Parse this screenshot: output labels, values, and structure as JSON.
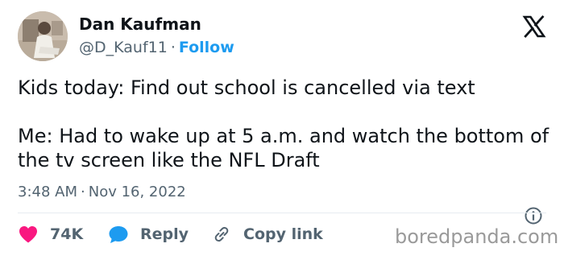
{
  "user": {
    "name": "Dan Kaufman",
    "handle": "@D_Kauf11",
    "separator": "·",
    "follow_label": "Follow"
  },
  "brand_icon": "x-logo-icon",
  "tweet": {
    "paragraphs": [
      "Kids today: Find out school is cancelled via text",
      "Me: Had to wake up at 5 a.m. and watch the bottom of the tv screen like the NFL Draft"
    ],
    "time": "3:48 AM",
    "separator": "·",
    "date": "Nov 16, 2022"
  },
  "actions": {
    "like_count": "74K",
    "reply_label": "Reply",
    "copy_link_label": "Copy link"
  },
  "watermark": "boredpanda.com",
  "colors": {
    "like": "#f91880",
    "accent": "#1d9bf0",
    "text": "#0f1419",
    "secondary": "#536471"
  }
}
